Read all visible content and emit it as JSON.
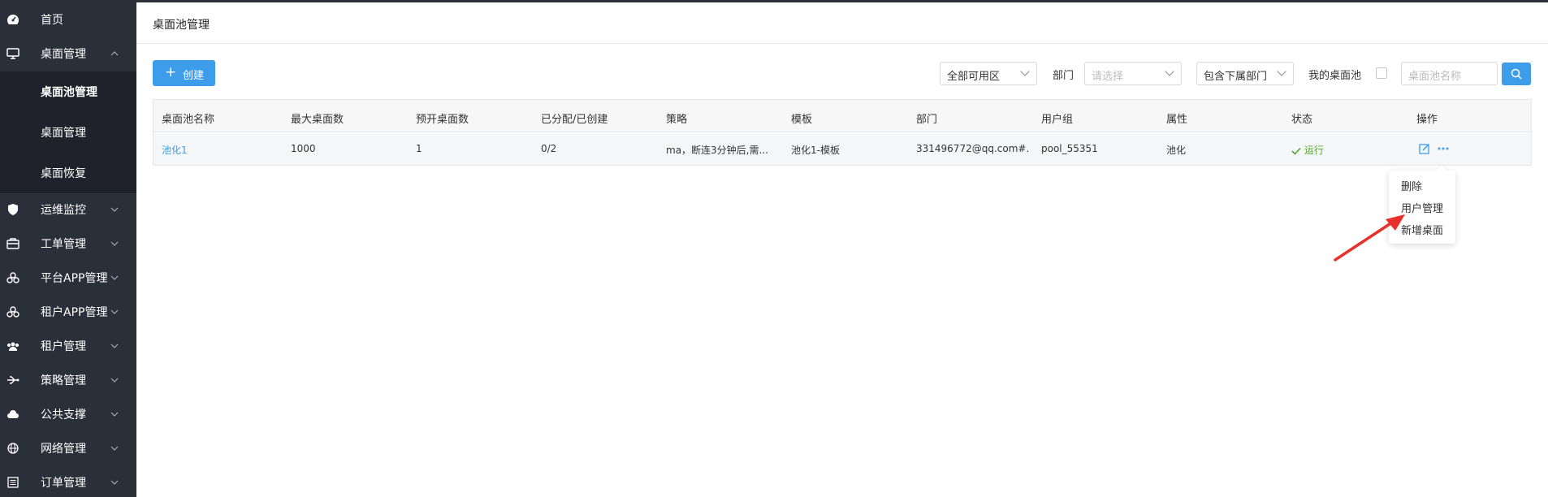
{
  "sidebar": {
    "items": [
      {
        "label": "首页",
        "icon": "dashboard-icon"
      },
      {
        "label": "桌面管理",
        "icon": "monitor-icon"
      },
      {
        "label": "运维监控",
        "icon": "shield-icon"
      },
      {
        "label": "工单管理",
        "icon": "briefcase-icon"
      },
      {
        "label": "平台APP管理",
        "icon": "apps-icon"
      },
      {
        "label": "租户APP管理",
        "icon": "apps-icon"
      },
      {
        "label": "租户管理",
        "icon": "users-icon"
      },
      {
        "label": "策略管理",
        "icon": "usb-icon"
      },
      {
        "label": "公共支撑",
        "icon": "cloud-icon"
      },
      {
        "label": "网络管理",
        "icon": "globe-icon"
      },
      {
        "label": "订单管理",
        "icon": "list-icon"
      }
    ],
    "submenu": [
      {
        "label": "桌面池管理"
      },
      {
        "label": "桌面管理"
      },
      {
        "label": "桌面恢复"
      }
    ]
  },
  "header": {
    "title": "桌面池管理"
  },
  "toolbar": {
    "create_label": "创建",
    "zone_select": "全部可用区",
    "dept_label": "部门",
    "dept_placeholder": "请选择",
    "sub_dept_select": "包含下属部门",
    "my_pool_label": "我的桌面池",
    "search_placeholder": "桌面池名称"
  },
  "table": {
    "columns": [
      "桌面池名称",
      "最大桌面数",
      "预开桌面数",
      "已分配/已创建",
      "策略",
      "模板",
      "部门",
      "用户组",
      "属性",
      "状态",
      "操作"
    ],
    "rows": [
      {
        "name": "池化1",
        "max": "1000",
        "pre": "1",
        "assigned": "0/2",
        "policy": "ma，断连3分钟后,需...",
        "template": "池化1-模板",
        "dept": "331496772@qq.com#...",
        "group": "pool_55351",
        "attr": "池化",
        "status": "运行"
      }
    ]
  },
  "dropdown": {
    "items": [
      "删除",
      "用户管理",
      "新增桌面"
    ]
  },
  "colors": {
    "accent": "#3d9dea",
    "sidebar": "#2b2f3a",
    "annotation": "#e8312a",
    "success": "#52a82d"
  }
}
